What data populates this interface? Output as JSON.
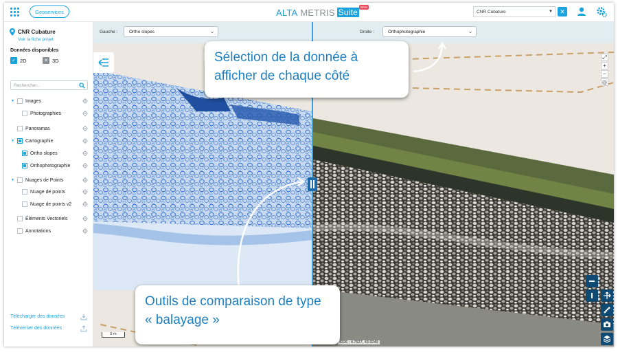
{
  "header": {
    "geoservices_label": "Geoservices",
    "logo_part_a": "ALTA",
    "logo_part_b": "METRIS",
    "logo_suite": "Suite",
    "logo_beta": "Beta",
    "project_select_value": "CNR Cubature"
  },
  "sidebar": {
    "project_name": "CNR Cubature",
    "project_link": "Voir la fiche projet",
    "available_title": "Données disponibles",
    "toggle_2d": "2D",
    "toggle_3d": "3D",
    "search_placeholder": "Rechercher...",
    "tree": [
      {
        "label": "Images",
        "level": 0,
        "chevron": true,
        "checked": false
      },
      {
        "label": "Photographies",
        "level": 1,
        "chevron": false,
        "checked": false
      },
      {
        "label": "Panoramas",
        "level": 0,
        "chevron": false,
        "checked": false
      },
      {
        "label": "Cartographie",
        "level": 0,
        "chevron": true,
        "checked": true
      },
      {
        "label": "Ortho slopes",
        "level": 1,
        "chevron": false,
        "checked": true
      },
      {
        "label": "Orthophotographie",
        "level": 1,
        "chevron": false,
        "checked": true
      },
      {
        "label": "Nuages de Points",
        "level": 0,
        "chevron": true,
        "checked": false
      },
      {
        "label": "Nuage de points",
        "level": 1,
        "chevron": false,
        "checked": false
      },
      {
        "label": "Nuage de points v2",
        "level": 1,
        "chevron": false,
        "checked": false
      },
      {
        "label": "Éléments Vectoriels",
        "level": 0,
        "chevron": false,
        "checked": false
      },
      {
        "label": "Annotations",
        "level": 0,
        "chevron": false,
        "checked": false
      }
    ],
    "download_label": "Télécharger des données",
    "upload_label": "Téléverser des données"
  },
  "map": {
    "left_label": "Gauche :",
    "left_value": "Ortho slopes",
    "right_label": "Droite :",
    "right_value": "Orthophotographie",
    "scale_label": "5 m",
    "coords_label": "4326 : 4.7527, 43.9249"
  },
  "callouts": {
    "top": "Sélection de la donnée à afficher de chaque côté",
    "bottom": "Outils de comparaison de type « balayage »"
  },
  "colors": {
    "accent": "#1aa3dd",
    "callout_text": "#1c7fbf",
    "tool_button": "#0f4a73"
  }
}
